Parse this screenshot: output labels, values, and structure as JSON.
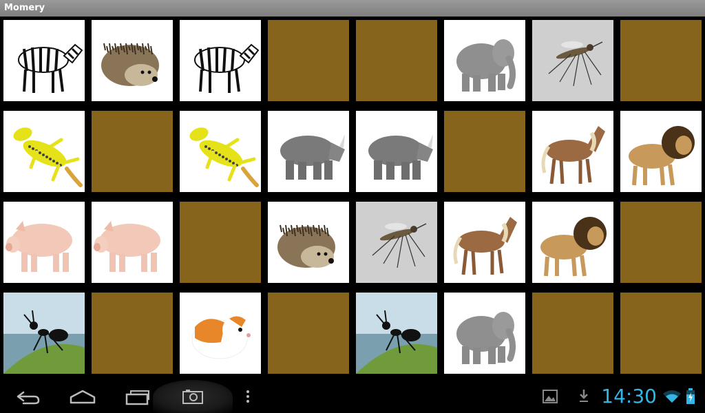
{
  "app": {
    "title": "Momery"
  },
  "board": {
    "cards": [
      {
        "animal": "zebra",
        "state": "revealed"
      },
      {
        "animal": "hedgehog",
        "state": "revealed"
      },
      {
        "animal": "zebra",
        "state": "revealed"
      },
      {
        "animal": null,
        "state": "hidden"
      },
      {
        "animal": null,
        "state": "hidden"
      },
      {
        "animal": "elephant",
        "state": "revealed"
      },
      {
        "animal": "mosquito",
        "state": "revealed"
      },
      {
        "animal": null,
        "state": "hidden"
      },
      {
        "animal": "gecko",
        "state": "revealed"
      },
      {
        "animal": null,
        "state": "hidden"
      },
      {
        "animal": "gecko",
        "state": "revealed"
      },
      {
        "animal": "rhino",
        "state": "revealed"
      },
      {
        "animal": "rhino",
        "state": "revealed"
      },
      {
        "animal": null,
        "state": "hidden"
      },
      {
        "animal": "horse",
        "state": "revealed"
      },
      {
        "animal": "lion",
        "state": "revealed"
      },
      {
        "animal": "pig",
        "state": "revealed"
      },
      {
        "animal": "pig",
        "state": "revealed"
      },
      {
        "animal": null,
        "state": "hidden"
      },
      {
        "animal": "hedgehog",
        "state": "revealed"
      },
      {
        "animal": "mosquito",
        "state": "revealed"
      },
      {
        "animal": "horse",
        "state": "revealed"
      },
      {
        "animal": "lion",
        "state": "revealed"
      },
      {
        "animal": null,
        "state": "hidden"
      },
      {
        "animal": "ant",
        "state": "revealed"
      },
      {
        "animal": null,
        "state": "hidden"
      },
      {
        "animal": "guinea-pig",
        "state": "revealed"
      },
      {
        "animal": null,
        "state": "hidden"
      },
      {
        "animal": "ant",
        "state": "revealed"
      },
      {
        "animal": "elephant",
        "state": "revealed"
      },
      {
        "animal": null,
        "state": "hidden"
      },
      {
        "animal": null,
        "state": "hidden"
      }
    ],
    "colors": {
      "hidden": "#86641c",
      "revealed": "#ffffff"
    }
  },
  "statusbar": {
    "time": "14:30",
    "time_color": "#33b5e5"
  },
  "navbar": {
    "icons": [
      "back-icon",
      "home-icon",
      "recent-apps-icon",
      "screenshot-icon",
      "menu-icon"
    ],
    "status_icons": [
      "gallery-icon",
      "download-icon",
      "wifi-icon",
      "battery-icon"
    ]
  }
}
